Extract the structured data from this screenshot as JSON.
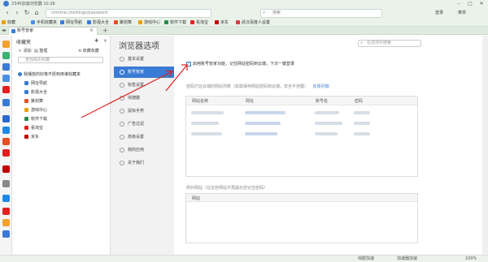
{
  "title_bar": {
    "title": "2345加速浏览器 10.26"
  },
  "nav": {
    "address": "chrome://settings/password",
    "search_placeholder": "搜索",
    "user_label": "登录",
    "menu_label": "菜单"
  },
  "bookmarks_bar": {
    "items": [
      {
        "label": "收藏",
        "color": "#e8a000"
      },
      {
        "label": "手机收藏夹",
        "color": "#4a90e2"
      },
      {
        "label": "网址导航",
        "color": "#3a7bd5"
      },
      {
        "label": "影视大全",
        "color": "#3a7bd5"
      },
      {
        "label": "聚划算",
        "color": "#e05020"
      },
      {
        "label": "游戏中心",
        "color": "#e8a000"
      },
      {
        "label": "软件下载",
        "color": "#2a8a4a"
      },
      {
        "label": "看淘宝",
        "color": "#e02020"
      },
      {
        "label": "京东",
        "color": "#c00000"
      },
      {
        "label": "武汉百度人设置",
        "color": "#d04040"
      }
    ]
  },
  "tab": {
    "label": "账号管家"
  },
  "favorites": {
    "header": "收藏夹",
    "add_label": "添加",
    "organize_label": "整理",
    "collect_label": "收藏收藏",
    "search_placeholder": "查找网页收藏",
    "folder_label": "我播放的好像不愿到用谁收藏夹",
    "items": [
      {
        "label": "网址导航",
        "color": "#3a7bd5"
      },
      {
        "label": "影视大全",
        "color": "#3a7bd5"
      },
      {
        "label": "聚划算",
        "color": "#e05020"
      },
      {
        "label": "游戏中心",
        "color": "#e8a000"
      },
      {
        "label": "软件下载",
        "color": "#2a8a4a"
      },
      {
        "label": "看淘宝",
        "color": "#e02020"
      },
      {
        "label": "京东",
        "color": "#c00000"
      }
    ]
  },
  "settings": {
    "title": "浏览器选项",
    "search_placeholder": "在选项中搜索",
    "nav": [
      {
        "label": "基本设置",
        "active": false
      },
      {
        "label": "账号管家",
        "active": true
      },
      {
        "label": "标签设置",
        "active": false
      },
      {
        "label": "快捷键",
        "active": false
      },
      {
        "label": "鼠标手势",
        "active": false
      },
      {
        "label": "广告过滤",
        "active": false
      },
      {
        "label": "高级设置",
        "active": false
      },
      {
        "label": "我的应用",
        "active": false
      },
      {
        "label": "关于我们",
        "active": false
      }
    ],
    "password_checkbox_label": "启用账号管家功能，记住网站密码到云端，下次一键登录",
    "password_checked": true,
    "saved_desc": "密码已在云端的网站列表（如需保存网站密码到云端，安全不泄露）",
    "feedback_link": "反馈问题",
    "table_headers": [
      "网站名称",
      "网址",
      "账号名",
      "密码"
    ],
    "exception_label": "例外网站（在这些网站不再提示您记住密码）",
    "exception_header": "网站"
  },
  "status_bar": {
    "items": [
      "戏剧加速",
      "加速器加速",
      "100%"
    ]
  },
  "colors": {
    "accent": "#3a7bd5",
    "annotation_red": "#e02020"
  }
}
